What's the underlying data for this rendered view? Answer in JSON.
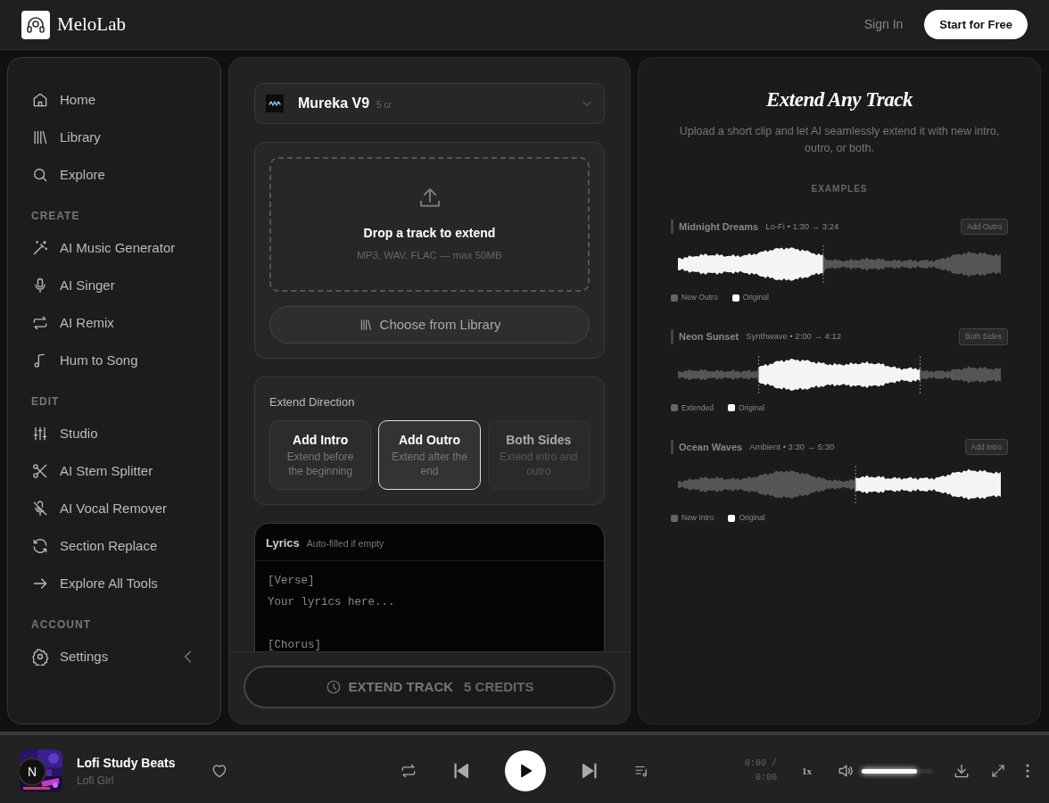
{
  "header": {
    "brand": "MeloLab",
    "sign_in": "Sign In",
    "cta": "Start for Free"
  },
  "sidebar": {
    "items": [
      {
        "kind": "link",
        "label": "Home"
      },
      {
        "kind": "link",
        "label": "Library"
      },
      {
        "kind": "link",
        "label": "Explore"
      },
      {
        "kind": "heading",
        "label": "CREATE"
      },
      {
        "kind": "link",
        "label": "AI Music Generator"
      },
      {
        "kind": "link",
        "label": "AI Singer"
      },
      {
        "kind": "link",
        "label": "AI Remix"
      },
      {
        "kind": "link",
        "label": "Hum to Song"
      },
      {
        "kind": "heading",
        "label": "EDIT"
      },
      {
        "kind": "link",
        "label": "Studio"
      },
      {
        "kind": "link",
        "label": "AI Stem Splitter"
      },
      {
        "kind": "link",
        "label": "AI Vocal Remover"
      },
      {
        "kind": "link",
        "label": "Section Replace"
      },
      {
        "kind": "link",
        "label": "Explore All Tools"
      },
      {
        "kind": "heading",
        "label": "ACCOUNT"
      },
      {
        "kind": "link",
        "label": "Settings"
      }
    ]
  },
  "model": {
    "name": "Mureka V9",
    "cost": "5 cr"
  },
  "upload": {
    "title": "Drop a track to extend",
    "hint": "MP3, WAV, FLAC — max 50MB",
    "library_button": "Choose from Library"
  },
  "direction": {
    "label": "Extend Direction",
    "options": [
      {
        "title": "Add Intro",
        "description": "Extend before the beginning",
        "selected": false,
        "disabled": false
      },
      {
        "title": "Add Outro",
        "description": "Extend after the end",
        "selected": true,
        "disabled": false
      },
      {
        "title": "Both Sides",
        "description": "Extend intro and outro",
        "selected": false,
        "disabled": true
      }
    ]
  },
  "lyrics": {
    "label": "Lyrics",
    "note": "Auto-filled if empty",
    "placeholder": "[Verse]\nYour lyrics here...\n\n[Chorus]"
  },
  "extend_button": {
    "label": "EXTEND TRACK",
    "credits": "5 CREDITS",
    "disabled": true
  },
  "showcase": {
    "title": "Extend Any Track",
    "subtitle": "Upload a short clip and let AI seamlessly extend it with new intro, outro, or both.",
    "examples_heading": "EXAMPLES",
    "examples": [
      {
        "kind": "outro",
        "title": "Midnight Dreams",
        "meta": "Lo-Fi • 1:30 → 3:24",
        "tag": "Add Outro",
        "legend": [
          {
            "label": "New Outro",
            "color": "#666666"
          },
          {
            "label": "Original",
            "color": "#ffffff"
          }
        ]
      },
      {
        "kind": "both",
        "title": "Neon Sunset",
        "meta": "Synthwave • 2:00 → 4:12",
        "tag": "Both Sides",
        "legend": [
          {
            "label": "Extended",
            "color": "#666666"
          },
          {
            "label": "Original",
            "color": "#ffffff"
          }
        ]
      },
      {
        "kind": "intro",
        "title": "Ocean Waves",
        "meta": "Ambient • 3:30 → 5:30",
        "tag": "Add Intro",
        "legend": [
          {
            "label": "New Intro",
            "color": "#666666"
          },
          {
            "label": "Original",
            "color": "#ffffff"
          }
        ]
      }
    ]
  },
  "player": {
    "progress": {
      "level": 0
    },
    "badge": "N",
    "track": "Lofi Study Beats",
    "artist": "Lofi Girl",
    "liked": false,
    "time": "0:00 / 0:00",
    "speed": "1x",
    "volume": {
      "level": 0.78
    }
  }
}
